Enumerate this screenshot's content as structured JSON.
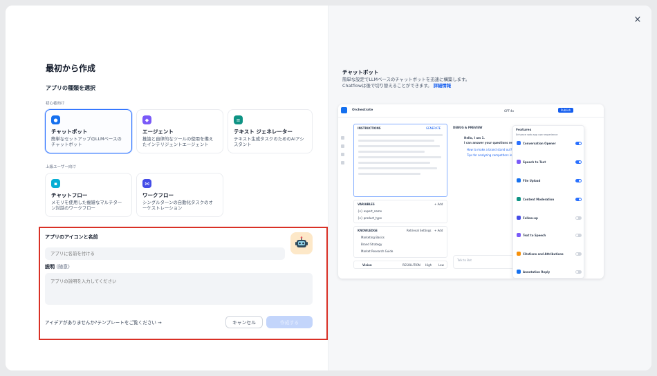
{
  "modal": {
    "close_icon": "×"
  },
  "left": {
    "page_title": "最初から作成",
    "section_title": "アプリの種類を選択",
    "beginner_label": "初心者向け",
    "advanced_label": "上級ユーザー向け",
    "app_types": [
      {
        "title": "チャットボット",
        "desc": "簡単なセットアップのLLMベースのチャットボット",
        "icon": "chatbot-icon",
        "color": "#1570ef"
      },
      {
        "title": "エージェント",
        "desc": "推論と自律的なツールの使用を備えたインテリジェントエージェント",
        "icon": "agent-icon",
        "color": "#7a5af8"
      },
      {
        "title": "テキスト ジェネレーター",
        "desc": "テキスト生成タスクのためのAIアシスタント",
        "icon": "text-generator-icon",
        "color": "#0e9384"
      },
      {
        "title": "チャットフロー",
        "desc": "メモリを使用した複雑なマルチターン対話のワークフロー",
        "icon": "chatflow-icon",
        "color": "#06aed4"
      },
      {
        "title": "ワークフロー",
        "desc": "シングルターンの自動化タスクのオーケストレーション",
        "icon": "workflow-icon",
        "color": "#444ce7"
      }
    ],
    "form": {
      "name_label": "アプリのアイコンと名前",
      "name_placeholder": "アプリに名前を付ける",
      "desc_label": "説明",
      "desc_optional": "(随意)",
      "desc_placeholder": "アプリの説明を入力してください",
      "template_link": "アイデアがありませんか?テンプレートをご覧ください →",
      "cancel_label": "キャンセル",
      "create_label": "作成する"
    }
  },
  "right": {
    "preview_title": "チャットボット",
    "preview_desc_1": "簡単な設定でLLMベースのチャットボットを迅速に構築します。",
    "preview_desc_2": "Chatflowは後で切り替えることができます。",
    "preview_link": "詳細情報",
    "shot": {
      "app_name": "Orchestrate",
      "model": "GPT-4o",
      "publish": "Publish",
      "instructions": "INSTRUCTIONS",
      "generate": "GENERATE",
      "variables": "VARIABLES",
      "var_rows": [
        "{x} expert_name",
        "{x} product_type"
      ],
      "knowledge": "KNOWLEDGE",
      "retrieval_setting": "Retrieval Settings",
      "add": "+ Add",
      "knowledge_rows": [
        "Marketing Basics",
        "Brand Strategy",
        "Market Research Guide"
      ],
      "vision": "Vision",
      "resolution": "RESOLUTION",
      "high": "High",
      "low": "Low",
      "debug_preview": "DEBUG & PREVIEW",
      "chat_greeting": "Hello, I am 1.",
      "chat_question": "I can answer your questions related",
      "chat_q1": "How to make a brand stand out?",
      "chat_q2": "Tips for analyzing competitors in marke",
      "talk_to_bot": "Talk to Bot",
      "features_title": "Features",
      "features_sub": "Enhance web app user experience",
      "features": [
        {
          "name": "Conversation Opener",
          "color": "#2970ff",
          "on": true
        },
        {
          "name": "Speech to Text",
          "color": "#7a5af8",
          "on": true
        },
        {
          "name": "File Upload",
          "color": "#1570ef",
          "on": true
        },
        {
          "name": "Content Moderation",
          "color": "#0e9384",
          "on": true
        },
        {
          "name": "Follow-up",
          "color": "#444ce7",
          "on": false
        },
        {
          "name": "Text to Speech",
          "color": "#7a5af8",
          "on": false
        },
        {
          "name": "Citations and Attributions",
          "color": "#f79009",
          "on": false
        },
        {
          "name": "Annotation Reply",
          "color": "#1570ef",
          "on": false
        }
      ]
    }
  }
}
